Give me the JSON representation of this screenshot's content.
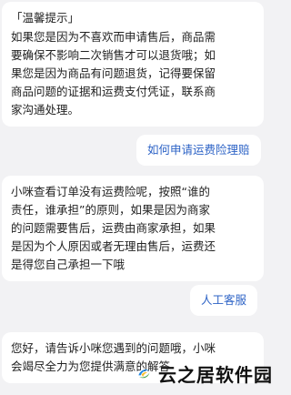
{
  "messages": [
    {
      "side": "left",
      "title": "「温馨提示」",
      "lines": [
        "如果您是因为不喜欢而申请售后，商品需",
        "要确保不影响二次销售才可以退货哦；如",
        "果您是因为商品有问题退货，记得要保留",
        "商品问题的证据和运费支付凭证，联系商",
        "家沟通处理。"
      ]
    },
    {
      "side": "right",
      "text": "如何申请运费险理赔"
    },
    {
      "side": "left",
      "lines": [
        "小咪查看订单没有运费险呢，按照“谁的",
        "责任，谁承担”的原则，如果是因为商家",
        "的问题需要售后，运费由商家承担，如果",
        "是因为个人原因或者无理由售后，运费还",
        "是得您自己承担一下哦"
      ]
    },
    {
      "side": "right",
      "text": "人工客服"
    },
    {
      "side": "left",
      "lines": [
        "您好，请告诉小咪您遇到的问题哦，小咪",
        "会竭尽全力为您提供满意的解答"
      ]
    }
  ],
  "watermark": {
    "text": "云之居软件园"
  },
  "colors": {
    "background": "#f2f2f4",
    "bubble": "#ffffff",
    "user_text": "#2d63c6"
  }
}
